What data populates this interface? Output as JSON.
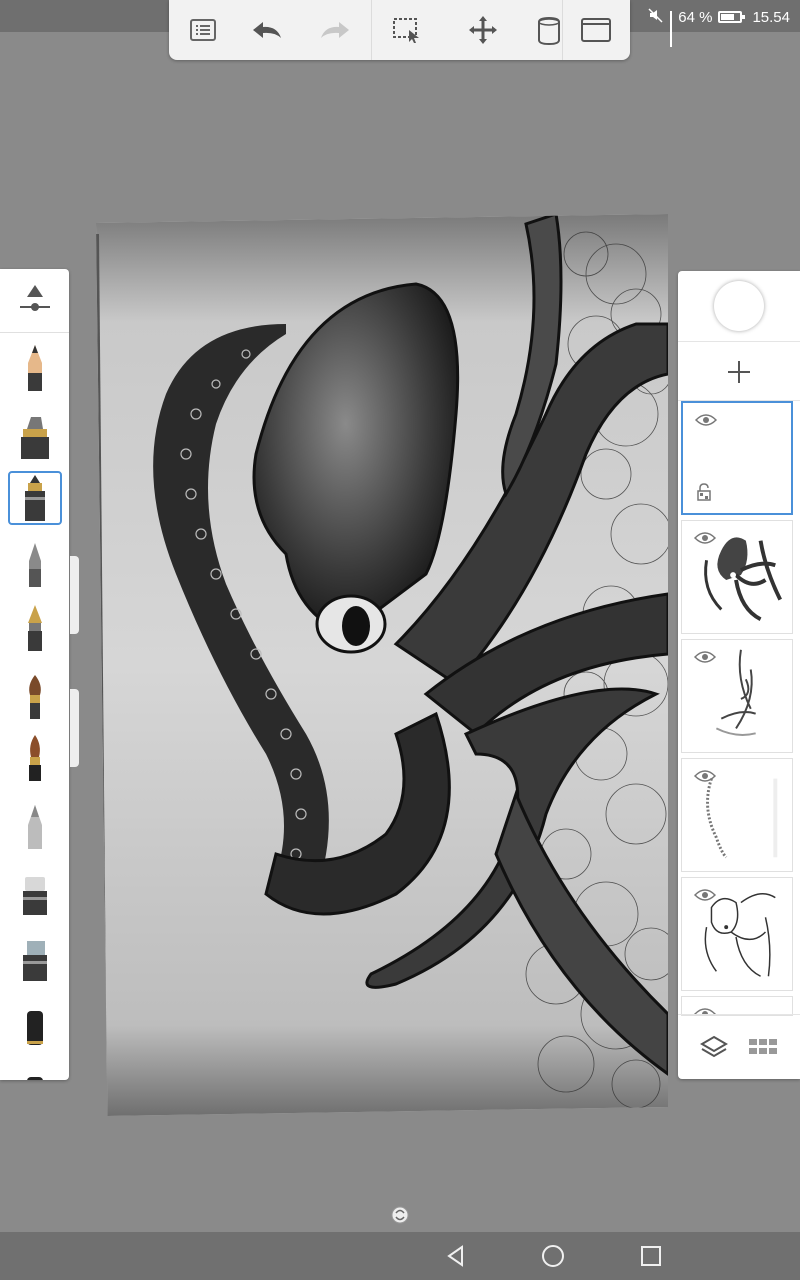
{
  "status": {
    "battery_percent": "64 %",
    "time": "15.54",
    "icons": [
      "mute-icon",
      "signal-icon",
      "battery-icon"
    ]
  },
  "toolbar": {
    "buttons": [
      "list-menu-icon",
      "undo-icon",
      "redo-icon",
      "select-icon",
      "move-icon",
      "bucket-icon",
      "fullscreen-icon"
    ]
  },
  "brush_palette": {
    "selected_index": 2,
    "brushes": [
      "pencil",
      "marker",
      "felt-pen",
      "ballpoint",
      "fountain-pen",
      "paint-brush",
      "ink-brush",
      "airbrush",
      "eraser",
      "hard-eraser",
      "soft-eraser"
    ]
  },
  "layers": {
    "color": "#ffffff",
    "active_index": 0,
    "items": [
      {
        "visible": true,
        "locked": true
      },
      {
        "visible": true
      },
      {
        "visible": true
      },
      {
        "visible": true
      },
      {
        "visible": true
      },
      {
        "visible": true
      }
    ]
  },
  "colors": {
    "accent": "#4a90d9",
    "background": "#8a8a8a",
    "panel": "#ffffff"
  }
}
